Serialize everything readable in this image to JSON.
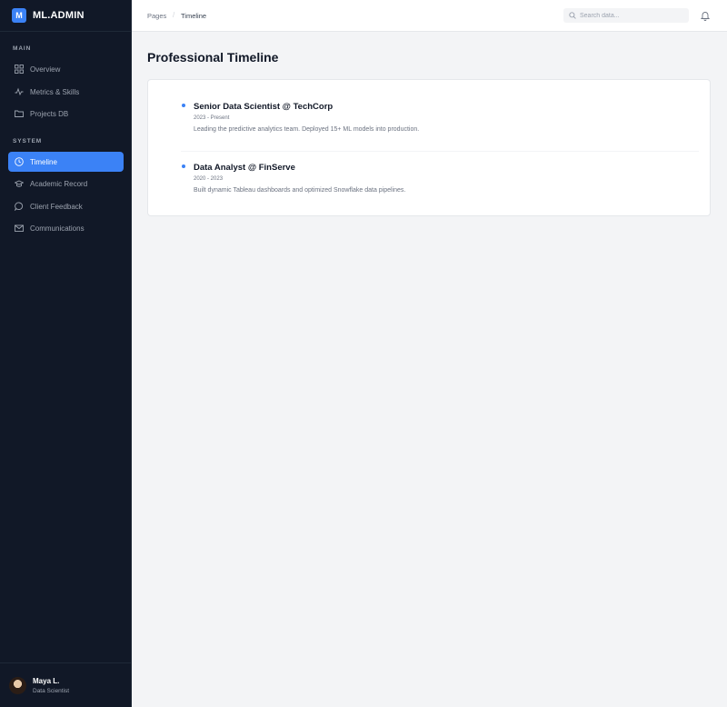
{
  "brand": {
    "mark": "M",
    "name": "ML.ADMIN"
  },
  "sidebar": {
    "main_label": "MAIN",
    "system_label": "SYSTEM",
    "main_items": [
      {
        "label": "Overview",
        "icon": "grid-icon"
      },
      {
        "label": "Metrics & Skills",
        "icon": "activity-icon"
      },
      {
        "label": "Projects DB",
        "icon": "folder-icon"
      }
    ],
    "system_items": [
      {
        "label": "Timeline",
        "icon": "clock-icon",
        "active": true
      },
      {
        "label": "Academic Record",
        "icon": "graduation-cap-icon"
      },
      {
        "label": "Client Feedback",
        "icon": "chat-bubble-icon"
      },
      {
        "label": "Communications",
        "icon": "mail-icon"
      }
    ]
  },
  "user": {
    "name": "Maya L.",
    "role": "Data Scientist"
  },
  "header": {
    "breadcrumb": [
      "Pages",
      "Timeline"
    ],
    "search_placeholder": "Search data...",
    "notification_icon": "bell-icon"
  },
  "main": {
    "title": "Professional Timeline",
    "entries": [
      {
        "role": "Senior Data Scientist @ TechCorp",
        "dates": "2023 - Present",
        "description": "Leading the predictive analytics team. Deployed 15+ ML models into production."
      },
      {
        "role": "Data Analyst @ FinServe",
        "dates": "2020 - 2023",
        "description": "Built dynamic Tableau dashboards and optimized Snowflake data pipelines."
      }
    ]
  },
  "colors": {
    "sidebar_bg": "#111827",
    "accent": "#3b82f6",
    "page_bg": "#f3f4f6"
  }
}
